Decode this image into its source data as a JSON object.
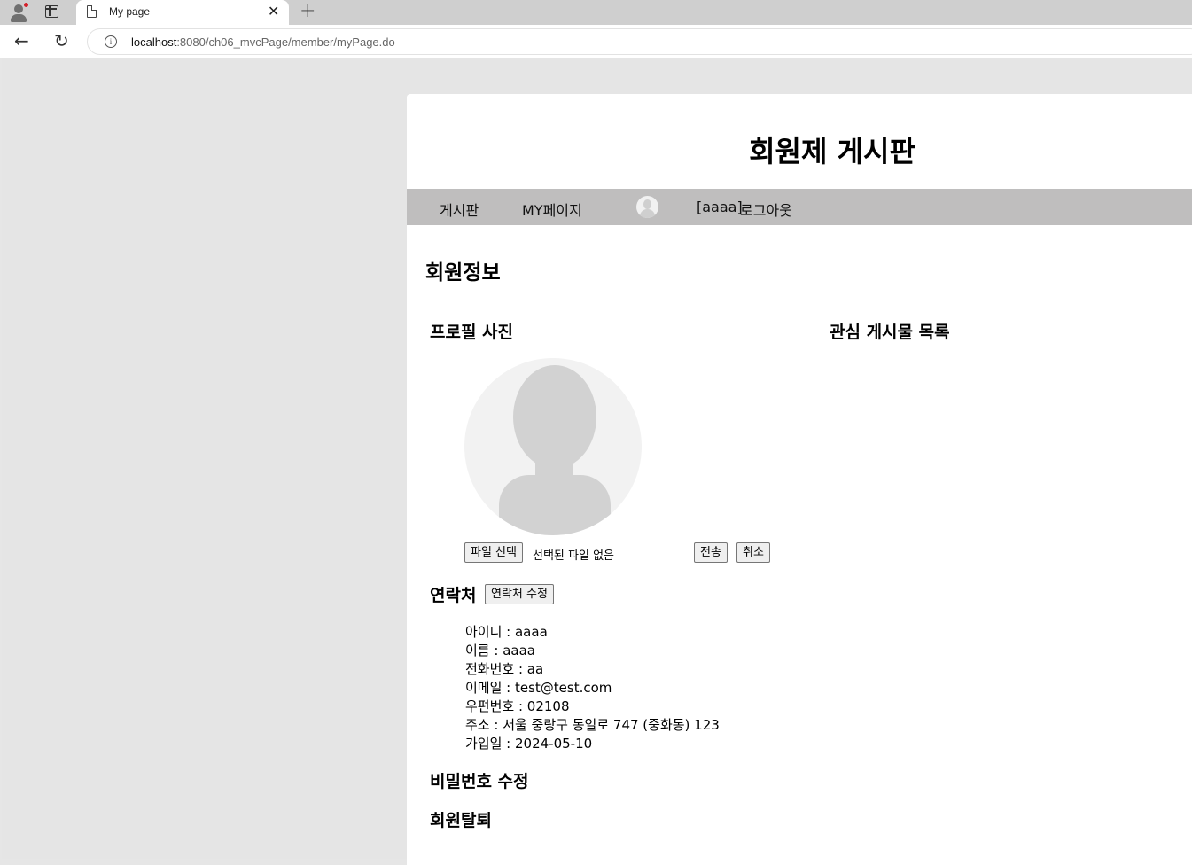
{
  "browser": {
    "tab_title": "My page",
    "url_host": "localhost",
    "url_rest": ":8080/ch06_mvcPage/member/myPage.do"
  },
  "site": {
    "title": "회원제 게시판"
  },
  "nav": {
    "board": "게시판",
    "mypage": "MY페이지",
    "user": "[aaaa]",
    "logout": "로그아웃"
  },
  "main": {
    "heading": "회원정보",
    "profile_heading": "프로필 사진",
    "favorites_heading": "관심 게시물 목록",
    "file_button": "파일 선택",
    "no_file": "선택된 파일 없음",
    "submit_button": "전송",
    "cancel_button": "취소",
    "contact_heading": "연락처",
    "edit_contact_button": "연락처 수정",
    "info": [
      "아이디 : aaaa",
      "이름 : aaaa",
      "전화번호 : aa",
      "이메일 : test@test.com",
      "우편번호 : 02108",
      "주소 : 서울 중랑구 동일로 747 (중화동) 123",
      "가입일 : 2024-05-10"
    ],
    "password_heading": "비밀번호 수정",
    "withdraw_heading": "회원탈퇴"
  }
}
